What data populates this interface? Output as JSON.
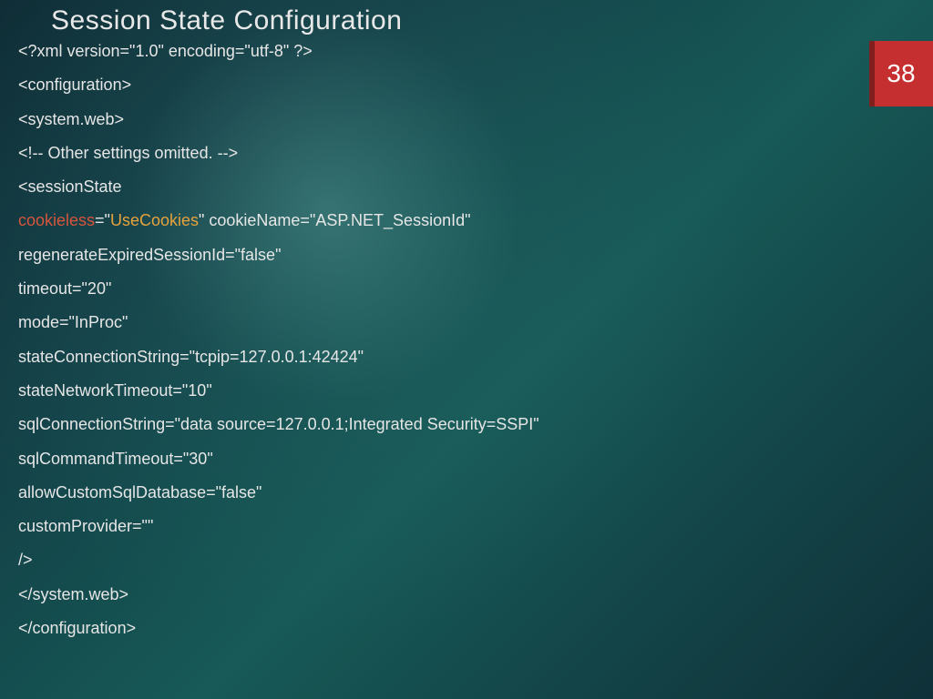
{
  "slide": {
    "title": "Session State Configuration",
    "page_number": "38"
  },
  "code": {
    "l01": "<?xml version=\"1.0\" encoding=\"utf-8\" ?>",
    "l02": "<configuration>",
    "l03": "<system.web>",
    "l04": "<!-- Other settings omitted. -->",
    "l05": "<sessionState",
    "l06a": "cookieless",
    "l06b": "=\"",
    "l06c": "UseCookies",
    "l06d": "\" cookieName=\"ASP.NET_SessionId\"",
    "l07": "regenerateExpiredSessionId=\"false\"",
    "l08": "timeout=\"20\"",
    "l09": "mode=\"InProc\"",
    "l10": "stateConnectionString=\"tcpip=127.0.0.1:42424\"",
    "l11": "stateNetworkTimeout=\"10\"",
    "l12": "sqlConnectionString=\"data source=127.0.0.1;Integrated Security=SSPI\"",
    "l13": "sqlCommandTimeout=\"30\"",
    "l14": "allowCustomSqlDatabase=\"false\"",
    "l15": "customProvider=\"\"",
    "l16": "/>",
    "l17": "</system.web>",
    "l18": "</configuration>"
  },
  "colors": {
    "accent_red": "#c62f2f",
    "highlight_attr": "#d6553c",
    "highlight_value": "#e6a23c"
  }
}
